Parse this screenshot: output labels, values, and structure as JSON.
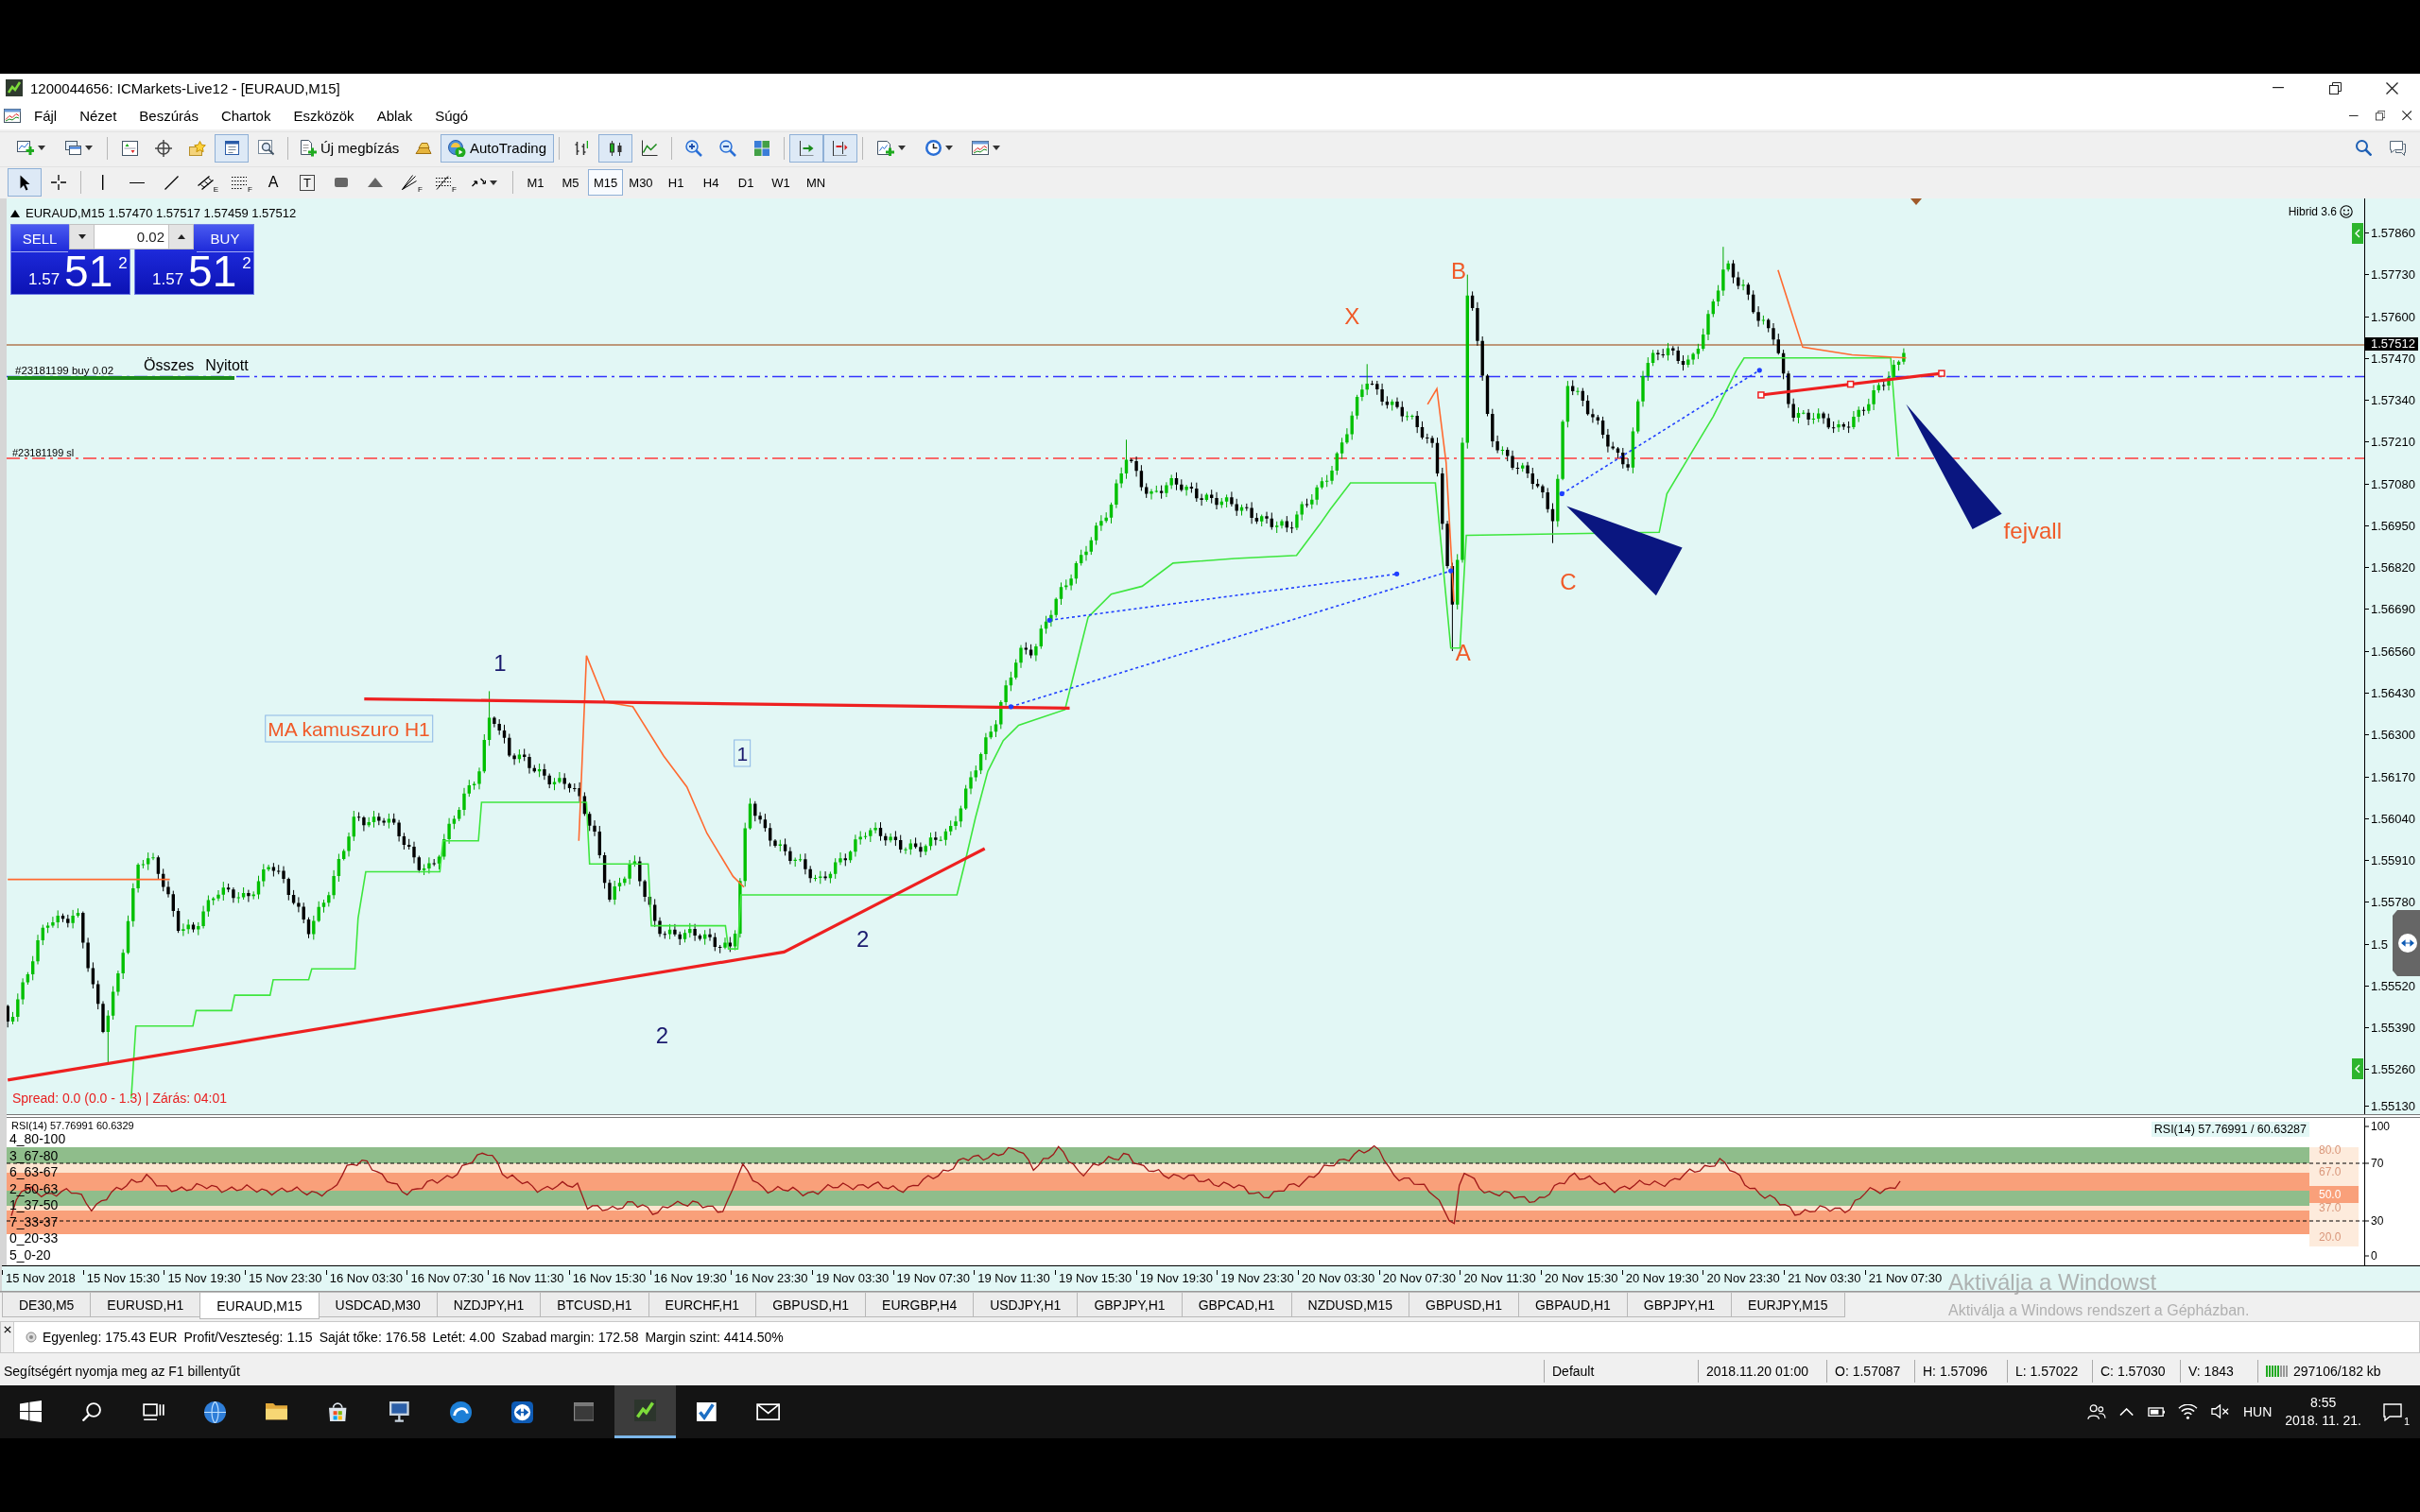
{
  "window": {
    "title": "1200044656: ICMarkets-Live12 - [EURAUD,M15]"
  },
  "menu": {
    "items": [
      "Fájl",
      "Nézet",
      "Beszúrás",
      "Chartok",
      "Eszközök",
      "Ablak",
      "Súgó"
    ]
  },
  "toolbar_main": {
    "groups": [
      [
        {
          "kind": "new-chart",
          "dropdown": true,
          "pressed": false
        },
        {
          "kind": "profiles",
          "dropdown": true,
          "pressed": false
        }
      ],
      [
        {
          "kind": "market-watch",
          "dropdown": false,
          "pressed": false
        },
        {
          "kind": "navigator",
          "dropdown": false,
          "pressed": false
        },
        {
          "kind": "favorites",
          "dropdown": false,
          "pressed": false
        },
        {
          "kind": "data-window",
          "dropdown": false,
          "pressed": true
        },
        {
          "kind": "tester",
          "dropdown": false,
          "pressed": false
        }
      ],
      [
        {
          "kind": "new-order",
          "label": "Új megbízás",
          "dropdown": false,
          "pressed": false
        },
        {
          "kind": "bullion",
          "dropdown": false,
          "pressed": false
        },
        {
          "kind": "autotrading",
          "label": "AutoTrading",
          "dropdown": false,
          "pressed": true
        }
      ],
      [
        {
          "kind": "bar-chart",
          "dropdown": false,
          "pressed": false
        },
        {
          "kind": "candles",
          "dropdown": false,
          "pressed": true
        },
        {
          "kind": "line-chart",
          "dropdown": false,
          "pressed": false
        }
      ],
      [
        {
          "kind": "zoom-in",
          "dropdown": false,
          "pressed": false
        },
        {
          "kind": "zoom-out",
          "dropdown": false,
          "pressed": false
        },
        {
          "kind": "tile",
          "dropdown": false,
          "pressed": false
        }
      ],
      [
        {
          "kind": "autoscroll",
          "dropdown": false,
          "pressed": true
        },
        {
          "kind": "chart-shift",
          "dropdown": false,
          "pressed": true
        }
      ],
      [
        {
          "kind": "indicators",
          "dropdown": true,
          "pressed": false
        },
        {
          "kind": "periods",
          "dropdown": true,
          "pressed": false
        },
        {
          "kind": "templates",
          "dropdown": true,
          "pressed": false
        }
      ]
    ],
    "right": [
      {
        "kind": "search"
      },
      {
        "kind": "chat"
      }
    ]
  },
  "toolbar_draw": {
    "groups": [
      [
        {
          "kind": "cursor",
          "dropdown": false,
          "pressed": true
        },
        {
          "kind": "crosshair",
          "dropdown": false,
          "pressed": false
        }
      ],
      [
        {
          "kind": "vertical-line",
          "dropdown": false,
          "pressed": false
        },
        {
          "kind": "horizontal-line",
          "dropdown": false,
          "pressed": false
        },
        {
          "kind": "trendline",
          "dropdown": false,
          "pressed": false
        },
        {
          "kind": "channel",
          "subscript": "E",
          "dropdown": false,
          "pressed": false
        },
        {
          "kind": "fibonacci",
          "subscript": "F",
          "dropdown": false,
          "pressed": false
        },
        {
          "kind": "text",
          "glyph": "A",
          "dropdown": false,
          "pressed": false
        },
        {
          "kind": "label",
          "glyph": "T",
          "dropdown": false,
          "pressed": false
        },
        {
          "kind": "rectangle",
          "dropdown": false,
          "pressed": false
        },
        {
          "kind": "triangle",
          "dropdown": false,
          "pressed": false
        },
        {
          "kind": "fan",
          "subscript": "F",
          "dropdown": false,
          "pressed": false
        },
        {
          "kind": "fibo-arcs",
          "subscript": "F",
          "dropdown": false,
          "pressed": false
        },
        {
          "kind": "arrows",
          "dropdown": true,
          "pressed": false
        }
      ]
    ],
    "timeframes": [
      {
        "label": "M1",
        "selected": false
      },
      {
        "label": "M5",
        "selected": false
      },
      {
        "label": "M15",
        "selected": true
      },
      {
        "label": "M30",
        "selected": false
      },
      {
        "label": "H1",
        "selected": false
      },
      {
        "label": "H4",
        "selected": false
      },
      {
        "label": "D1",
        "selected": false
      },
      {
        "label": "W1",
        "selected": false
      },
      {
        "label": "MN",
        "selected": false
      }
    ]
  },
  "chart": {
    "header": "EURAUD,M15 1.57470 1.57517 1.57459 1.57512",
    "one_click": {
      "sell": {
        "label": "SELL",
        "price_big": "1.57",
        "price_pips": "51",
        "price_point": "2"
      },
      "lot": "0.02",
      "buy": {
        "label": "BUY",
        "price_big": "1.57",
        "price_pips": "51",
        "price_point": "2"
      }
    },
    "indicator_label": "Hibrid 3.6",
    "order_lines": [
      {
        "kind": "bid"
      },
      {
        "kind": "order",
        "label": "#23181199 buy 0.02"
      },
      {
        "kind": "stop-loss",
        "label": "#23181199 sl"
      }
    ],
    "order_filters": [
      "Összes",
      "Nyitott"
    ],
    "annotations": [
      {
        "kind": "text",
        "text": "X",
        "color": "#f05a28"
      },
      {
        "kind": "text",
        "text": "B",
        "color": "#f05a28"
      },
      {
        "kind": "text",
        "text": "A",
        "color": "#f05a28"
      },
      {
        "kind": "text",
        "text": "C",
        "color": "#f05a28"
      },
      {
        "kind": "text",
        "text": "fejvall",
        "color": "#f05a28"
      },
      {
        "kind": "text",
        "text": "1",
        "color": "#1a1a6e"
      },
      {
        "kind": "boxed",
        "text": "1",
        "color": "#1a1a6e"
      },
      {
        "kind": "text",
        "text": "2",
        "color": "#1a1a6e"
      },
      {
        "kind": "text",
        "text": "2",
        "color": "#1a1a6e"
      },
      {
        "kind": "boxed",
        "text": "MA kamuszuro H1",
        "color": "#f05a28"
      }
    ],
    "spread": "Spread: 0.0 (0.0 - 1.3) | Zárás: 04:01",
    "price_axis": {
      "labels": [
        "1.57860",
        "1.57730",
        "1.57600",
        "1.57470",
        "1.57340",
        "1.57210",
        "1.57080",
        "1.56950",
        "1.56820",
        "1.56690",
        "1.56560",
        "1.56430",
        "1.56300",
        "1.56170",
        "1.56040",
        "1.55910",
        "1.55780",
        "1.5",
        "1.55520",
        "1.55390",
        "1.55260",
        "1.55130"
      ],
      "current": "1.57512"
    }
  },
  "rsi": {
    "title": "RSI(14) 57.76991 60.6329",
    "levels": [
      "4_80-100",
      "3_67-80",
      "6_63-67",
      "2_50-63",
      "1_37-50",
      "7_33-37",
      "0_20-33",
      "5_0-20"
    ],
    "band_labels": [
      "80.0",
      "67.0",
      "50.0",
      "37.0",
      "20.0"
    ],
    "reading": "RSI(14) 57.76991 / 60.63287",
    "axis": [
      "100",
      "70",
      "30",
      "0"
    ]
  },
  "time_axis": [
    "15 Nov 2018",
    "15 Nov 15:30",
    "15 Nov 19:30",
    "15 Nov 23:30",
    "16 Nov 03:30",
    "16 Nov 07:30",
    "16 Nov 11:30",
    "16 Nov 15:30",
    "16 Nov 19:30",
    "16 Nov 23:30",
    "19 Nov 03:30",
    "19 Nov 07:30",
    "19 Nov 11:30",
    "19 Nov 15:30",
    "19 Nov 19:30",
    "19 Nov 23:30",
    "20 Nov 03:30",
    "20 Nov 07:30",
    "20 Nov 11:30",
    "20 Nov 15:30",
    "20 Nov 19:30",
    "20 Nov 23:30",
    "21 Nov 03:30",
    "21 Nov 07:30"
  ],
  "tabs": [
    {
      "label": "DE30,M5",
      "selected": false
    },
    {
      "label": "EURUSD,H1",
      "selected": false
    },
    {
      "label": "EURAUD,M15",
      "selected": true
    },
    {
      "label": "USDCAD,M30",
      "selected": false
    },
    {
      "label": "NZDJPY,H1",
      "selected": false
    },
    {
      "label": "BTCUSD,H1",
      "selected": false
    },
    {
      "label": "EURCHF,H1",
      "selected": false
    },
    {
      "label": "GBPUSD,H1",
      "selected": false
    },
    {
      "label": "EURGBP,H4",
      "selected": false
    },
    {
      "label": "USDJPY,H1",
      "selected": false
    },
    {
      "label": "GBPJPY,H1",
      "selected": false
    },
    {
      "label": "GBPCAD,H1",
      "selected": false
    },
    {
      "label": "NZDUSD,M15",
      "selected": false
    },
    {
      "label": "GBPUSD,H1",
      "selected": false
    },
    {
      "label": "GBPAUD,H1",
      "selected": false
    },
    {
      "label": "GBPJPY,H1",
      "selected": false
    },
    {
      "label": "EURJPY,M15",
      "selected": false
    }
  ],
  "activation_notice": {
    "title": "Aktiválja a Windowst",
    "text": "Aktiválja a Windows rendszert a Gépházban."
  },
  "terminal": {
    "items": [
      "Egyenleg: 175.43 EUR",
      "Profit/Veszteség: 1.15",
      "Saját tőke: 176.58",
      "Letét: 4.00",
      "Szabad margin: 172.58",
      "Margin szint: 4414.50%"
    ]
  },
  "status_bar": {
    "hint": "Segítségért nyomja meg az F1 billentyűt",
    "fields": [
      "Default",
      "2018.11.20 01:00",
      "O: 1.57087",
      "H: 1.57096",
      "L: 1.57022",
      "C: 1.57030",
      "V: 1843"
    ],
    "traffic": "297106/182 kb"
  },
  "taskbar": {
    "apps": [
      {
        "kind": "start",
        "active": false
      },
      {
        "kind": "search",
        "active": false
      },
      {
        "kind": "task-view",
        "active": false
      },
      {
        "kind": "globe",
        "active": false
      },
      {
        "kind": "folder",
        "active": false
      },
      {
        "kind": "store",
        "active": false
      },
      {
        "kind": "monitor",
        "active": false
      },
      {
        "kind": "browser",
        "active": false
      },
      {
        "kind": "remote",
        "active": false
      },
      {
        "kind": "terminal",
        "active": false
      },
      {
        "kind": "trading",
        "active": true
      },
      {
        "kind": "check",
        "active": false
      },
      {
        "kind": "mail",
        "active": false
      }
    ],
    "tray": {
      "icons": [
        {
          "kind": "people"
        },
        {
          "kind": "chevron"
        },
        {
          "kind": "battery"
        },
        {
          "kind": "wifi"
        },
        {
          "kind": "speaker-muted"
        }
      ],
      "language": "HUN",
      "time": "8:55",
      "date": "2018. 11. 21.",
      "notifications": "1"
    }
  }
}
